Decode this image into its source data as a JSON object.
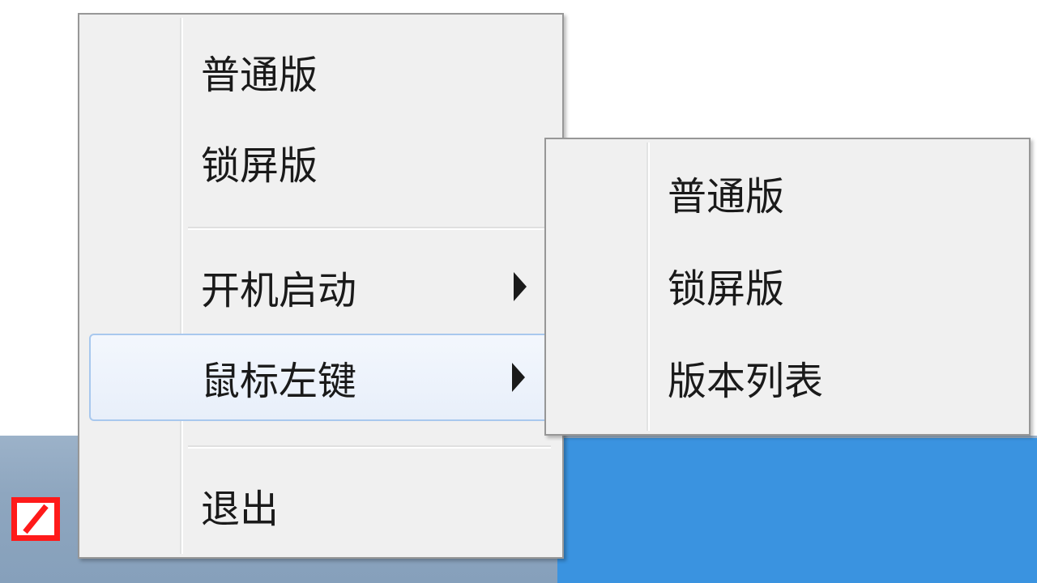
{
  "main_menu": {
    "items": [
      {
        "label": "普通版"
      },
      {
        "label": "锁屏版"
      },
      {
        "label": "开机启动"
      },
      {
        "label": "鼠标左键"
      },
      {
        "label": "退出"
      }
    ]
  },
  "submenu": {
    "items": [
      {
        "label": "普通版"
      },
      {
        "label": "锁屏版"
      },
      {
        "label": "版本列表"
      }
    ]
  },
  "colors": {
    "menu_background": "#f0f0f0",
    "highlight_border": "#a8c8ee",
    "tray_icon": "#ff1a1a",
    "taskbar": "#8ea6bf",
    "blue_region": "#3a93e0"
  }
}
